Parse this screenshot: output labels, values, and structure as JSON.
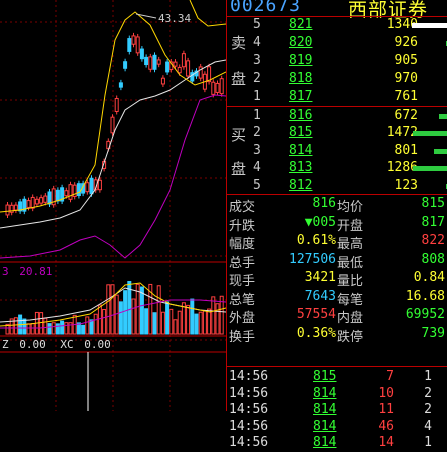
{
  "header": {
    "code": "002673",
    "name": "西部证券"
  },
  "chart": {
    "high_label": "43.34",
    "ma_readout_prefix": "3",
    "ma_readout_value": "20.81",
    "z_label": "Z",
    "z_value": "0.00",
    "xc_label": "XC",
    "xc_value": "0.00"
  },
  "order_book": {
    "sell_label_top": "卖",
    "sell_label_bottom": "盘",
    "buy_label_top": "买",
    "buy_label_bottom": "盘",
    "asks": [
      {
        "level": "5",
        "price": "821",
        "volume": "1340",
        "bar": 0.78
      },
      {
        "level": "4",
        "price": "820",
        "volume": "926",
        "bar": 0.04
      },
      {
        "level": "3",
        "price": "819",
        "volume": "905",
        "bar": 0.03
      },
      {
        "level": "2",
        "price": "818",
        "volume": "970",
        "bar": 0.03
      },
      {
        "level": "1",
        "price": "817",
        "volume": "761",
        "bar": 0.03
      }
    ],
    "bids": [
      {
        "level": "1",
        "price": "816",
        "volume": "672",
        "bar": 0.2
      },
      {
        "level": "2",
        "price": "815",
        "volume": "1472",
        "bar": 0.75
      },
      {
        "level": "3",
        "price": "814",
        "volume": "801",
        "bar": 0.3
      },
      {
        "level": "4",
        "price": "813",
        "volume": "1286",
        "bar": 0.75
      },
      {
        "level": "5",
        "price": "812",
        "volume": "123",
        "bar": 0.05
      }
    ]
  },
  "quote": {
    "rows": [
      {
        "l1": "成交",
        "v1": "816",
        "c1": "gr",
        "l2": "均价",
        "v2": "815",
        "c2": "gr"
      },
      {
        "l1": "升跌",
        "v1": "▼005",
        "c1": "gr",
        "l2": "开盘",
        "v2": "817",
        "c2": "gr"
      },
      {
        "l1": "幅度",
        "v1": "0.61%",
        "c1": "yl",
        "l2": "最高",
        "v2": "822",
        "c2": "rd"
      },
      {
        "l1": "总手",
        "v1": "127506",
        "c1": "cy",
        "l2": "最低",
        "v2": "808",
        "c2": "gr"
      },
      {
        "l1": "现手",
        "v1": "3421",
        "c1": "yl",
        "l2": "量比",
        "v2": "0.84",
        "c2": "yl"
      },
      {
        "l1": "总笔",
        "v1": "7643",
        "c1": "cy",
        "l2": "每笔",
        "v2": "16.68",
        "c2": "yl"
      },
      {
        "l1": "外盘",
        "v1": "57554",
        "c1": "rd",
        "l2": "内盘",
        "v2": "69952",
        "c2": "gr"
      },
      {
        "l1": "换手",
        "v1": "0.36%",
        "c1": "yl",
        "l2": "跌停",
        "v2": "739",
        "c2": "gr"
      }
    ]
  },
  "ticks": [
    {
      "time": "14:56",
      "price": "815",
      "vol": "7",
      "cnt": "1"
    },
    {
      "time": "14:56",
      "price": "814",
      "vol": "10",
      "cnt": "2"
    },
    {
      "time": "14:56",
      "price": "814",
      "vol": "11",
      "cnt": "2"
    },
    {
      "time": "14:56",
      "price": "814",
      "vol": "46",
      "cnt": "4"
    },
    {
      "time": "14:56",
      "price": "814",
      "vol": "14",
      "cnt": "1"
    }
  ]
}
